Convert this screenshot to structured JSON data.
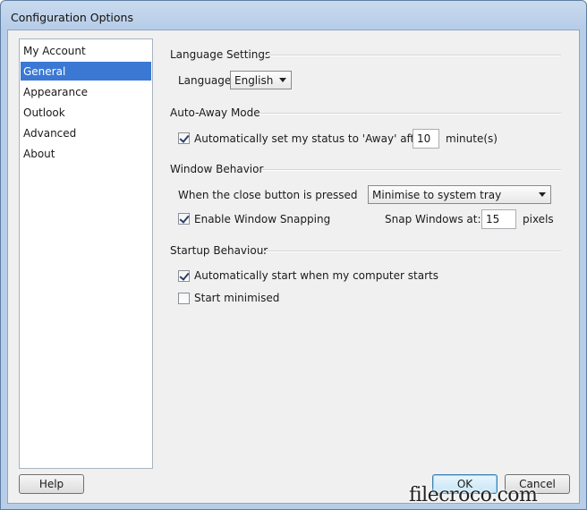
{
  "window": {
    "title": "Configuration Options"
  },
  "sidebar": {
    "items": [
      {
        "label": "My Account"
      },
      {
        "label": "General",
        "selected": true
      },
      {
        "label": "Appearance"
      },
      {
        "label": "Outlook"
      },
      {
        "label": "Advanced"
      },
      {
        "label": "About"
      }
    ]
  },
  "language": {
    "section_title": "Language Settings",
    "label": "Language",
    "value": "English"
  },
  "auto_away": {
    "section_title": "Auto-Away Mode",
    "checkbox_label": "Automatically set my status to 'Away' after",
    "checked": true,
    "minutes_value": "10",
    "unit": "minute(s)"
  },
  "window_behavior": {
    "section_title": "Window Behavior",
    "close_label": "When the close button is pressed",
    "close_value": "Minimise to system tray",
    "snapping_label": "Enable Window Snapping",
    "snapping_checked": true,
    "snap_at_label": "Snap Windows at:",
    "snap_value": "15",
    "snap_unit": "pixels"
  },
  "startup": {
    "section_title": "Startup Behaviour",
    "auto_start_label": "Automatically start when my computer starts",
    "auto_start_checked": true,
    "minimised_label": "Start minimised",
    "minimised_checked": false
  },
  "footer": {
    "help_label": "Help",
    "ok_label": "OK",
    "cancel_label": "Cancel"
  },
  "watermark": {
    "text": "filecroco.com"
  }
}
